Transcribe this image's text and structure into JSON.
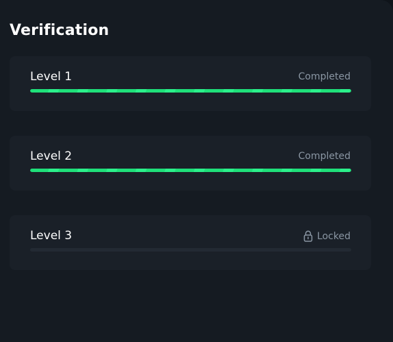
{
  "header": {
    "title": "Verification"
  },
  "levels": [
    {
      "label": "Level 1",
      "status": "Completed",
      "progress": 1.0
    },
    {
      "label": "Level 2",
      "status": "Completed",
      "progress": 1.0
    },
    {
      "label": "Level 3",
      "status": "Locked",
      "progress": 0.0,
      "status_icon": "lock-icon"
    }
  ],
  "colors": {
    "progress_fill": "#1fe07a",
    "track": "#232a33",
    "card_bg": "#1a2028",
    "panel_bg": "#151b22",
    "muted_text": "#8a96a3"
  }
}
